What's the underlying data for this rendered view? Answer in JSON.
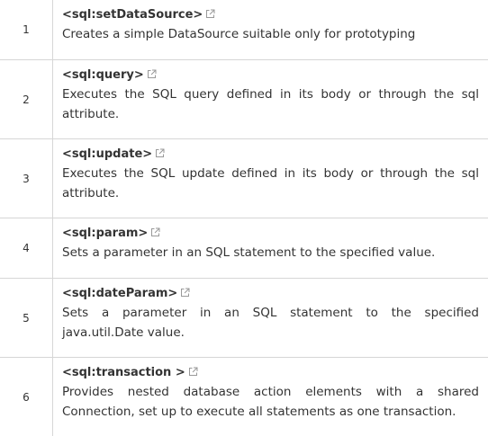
{
  "rows": [
    {
      "number": "1",
      "tag": "<sql:setDataSource>",
      "description": "Creates a simple DataSource suitable only for prototyping"
    },
    {
      "number": "2",
      "tag": "<sql:query>",
      "description": "Executes the SQL query defined in its body or through the sql attribute."
    },
    {
      "number": "3",
      "tag": "<sql:update>",
      "description": "Executes the SQL update defined in its body or through the sql attribute."
    },
    {
      "number": "4",
      "tag": "<sql:param>",
      "description": "Sets a parameter in an SQL statement to the specified value."
    },
    {
      "number": "5",
      "tag": "<sql:dateParam>",
      "description": "Sets a parameter in an SQL statement to the specified java.util.Date value."
    },
    {
      "number": "6",
      "tag": "<sql:transaction >",
      "description": "Provides nested database action elements with a shared Connection, set up to execute all statements as one transaction."
    }
  ],
  "icons": {
    "external_link": "external-link-icon"
  }
}
